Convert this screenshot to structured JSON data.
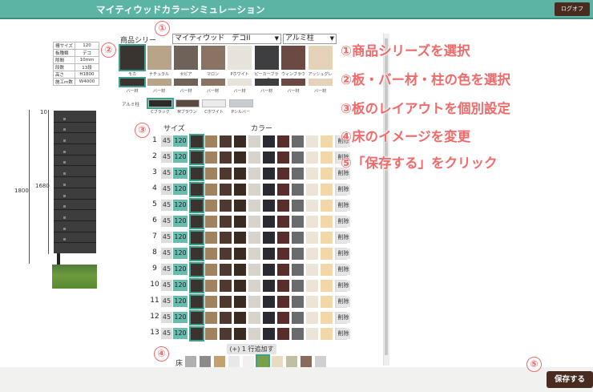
{
  "app": {
    "title": "マイティウッドカラーシミュレーション",
    "logout_label": "ログオフ",
    "save_label": "保存する"
  },
  "callouts": [
    "①",
    "②",
    "③",
    "④",
    "⑤"
  ],
  "spec_table": [
    [
      "柵サイズ",
      "120"
    ],
    [
      "板種類",
      "デコ"
    ],
    [
      "隙間",
      "10mm"
    ],
    [
      "段数",
      "13段"
    ],
    [
      "高さ",
      "H1800"
    ],
    [
      "施工m数",
      "W4000"
    ]
  ],
  "preview": {
    "height_total": "1800",
    "height_panel": "1680",
    "top_gap": "10"
  },
  "product": {
    "label": "商品シリー",
    "series_value": "マイティウッド　デコII",
    "post_value": "アルミ柱"
  },
  "board_colors": [
    {
      "name": "モカ",
      "color": "#3a3430"
    },
    {
      "name": "ナチュラル",
      "color": "#b8a488"
    },
    {
      "name": "セピア",
      "color": "#6e6259"
    },
    {
      "name": "マロン",
      "color": "#8a7264"
    },
    {
      "name": "Pホワイト",
      "color": "#e8e3da"
    },
    {
      "name": "ピーカーブラック",
      "color": "#3e3e40"
    },
    {
      "name": "ウィンブラウン",
      "color": "#6a4a42"
    },
    {
      "name": "アッシュグレー",
      "color": "#e5d2b8"
    }
  ],
  "bar_label": "バー材",
  "pillar_label": "アルミ柱",
  "pillar_colors": [
    {
      "name": "Cブラック",
      "color": "#2a2a2a"
    },
    {
      "name": "Mブラウン",
      "color": "#5a4a42"
    },
    {
      "name": "Cホワイト",
      "color": "#ececec"
    },
    {
      "name": "Pシルバー",
      "color": "#c8ccd0"
    }
  ],
  "table": {
    "size_header": "サイズ",
    "color_header": "カラー",
    "size_small": "45",
    "size_large": "120",
    "delete_label": "削除",
    "rows": [
      "1",
      "2",
      "3",
      "4",
      "5",
      "6",
      "7",
      "8",
      "9",
      "10",
      "11",
      "12",
      "13"
    ],
    "cell_colors": [
      "#3a3430",
      "#a0825e",
      "#4e3830",
      "#3a2a22",
      "#d8d3cc",
      "#2a2a30",
      "#5a2d2d",
      "#6b6b6e",
      "#ede4d8",
      "#f2d7a8",
      "#dcdcdc"
    ]
  },
  "add_row_label": "(+) 1 行追加する",
  "floor": {
    "label": "床",
    "colors": [
      "#b0b0b0",
      "#8a8a8a",
      "#c2a070",
      "#e8e8e8",
      "#f0f0f0",
      "#7aa04a",
      "#e8dcc0",
      "#c0c0a0",
      "#8a6a5a",
      "#d0d0d0"
    ]
  },
  "steps": [
    "①商品シリーズを選択",
    "②板・バー材・柱の色を選択",
    "③板のレイアウトを個別設定",
    "④床のイメージを変更",
    "⑤「保存する」をクリック"
  ],
  "colors": {
    "accent": "#5cb5a4",
    "brand_dark": "#4a2b20",
    "callout": "#f06a6a"
  }
}
